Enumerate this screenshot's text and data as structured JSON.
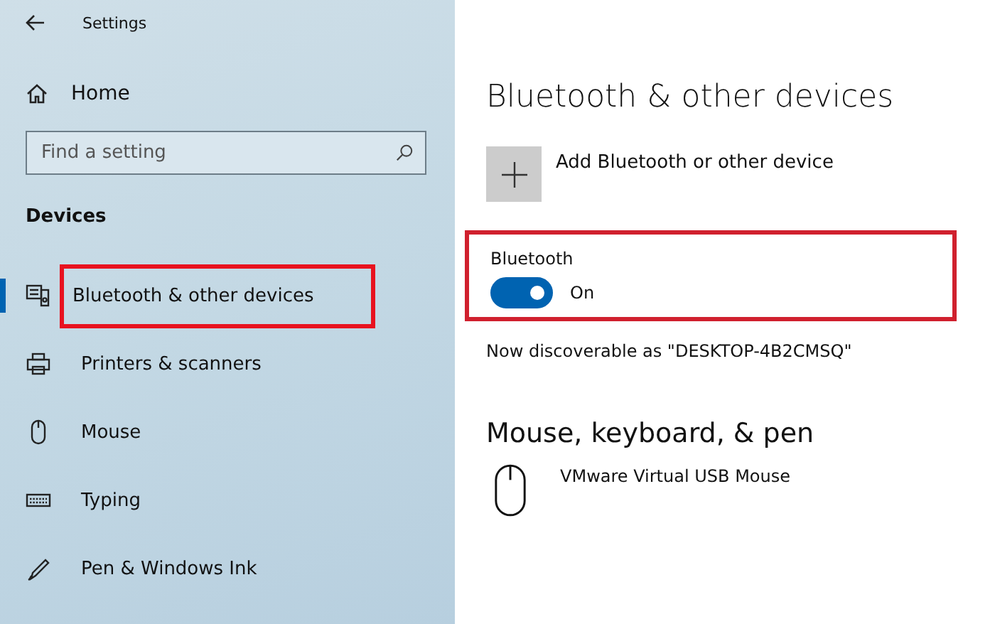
{
  "window": {
    "title": "Settings"
  },
  "sidebar": {
    "home": "Home",
    "search": {
      "placeholder": "Find a setting"
    },
    "section": "Devices",
    "items": [
      {
        "label": "Bluetooth & other devices",
        "selected": true,
        "highlighted": true
      },
      {
        "label": "Printers & scanners",
        "selected": false,
        "highlighted": false
      },
      {
        "label": "Mouse",
        "selected": false,
        "highlighted": false
      },
      {
        "label": "Typing",
        "selected": false,
        "highlighted": false
      },
      {
        "label": "Pen & Windows Ink",
        "selected": false,
        "highlighted": false
      }
    ]
  },
  "main": {
    "title": "Bluetooth & other devices",
    "add_device": "Add Bluetooth or other device",
    "bluetooth": {
      "label": "Bluetooth",
      "on": true,
      "state_text": "On",
      "highlighted": true
    },
    "discoverable": "Now discoverable as \"DESKTOP-4B2CMSQ\"",
    "section": "Mouse, keyboard, & pen",
    "devices": [
      {
        "name": "VMware Virtual USB Mouse"
      }
    ]
  }
}
